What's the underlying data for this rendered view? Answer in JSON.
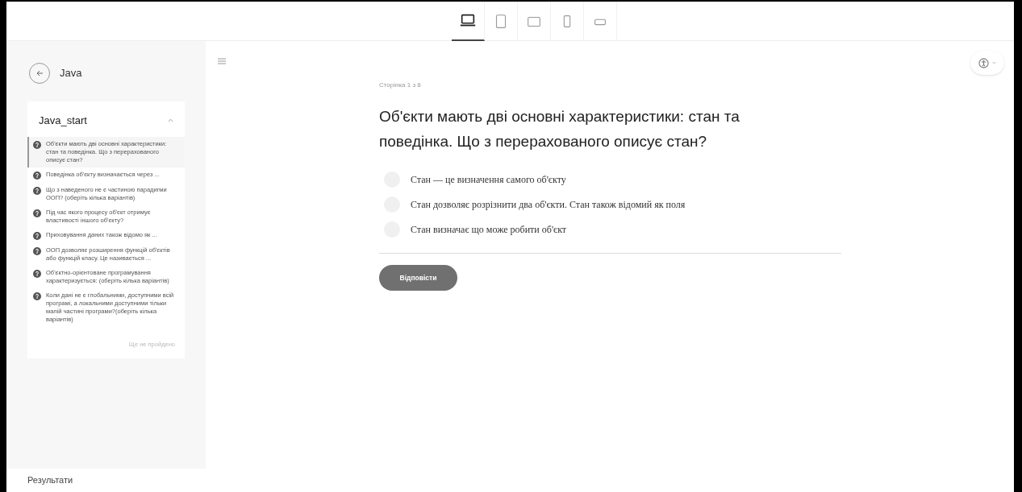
{
  "device_tabs": [
    {
      "kind": "laptop",
      "selected": true
    },
    {
      "kind": "tablet",
      "selected": false
    },
    {
      "kind": "tablet-landscape",
      "selected": false
    },
    {
      "kind": "phone",
      "selected": false
    },
    {
      "kind": "phone-landscape",
      "selected": false
    }
  ],
  "sidebar": {
    "back_label": "Java",
    "section": {
      "title": "Java_start",
      "expanded": true,
      "items": [
        {
          "text": "Об'єкти мають дві основні характеристики: стан та поведінка. Що з перерахованого описує стан?",
          "selected": true
        },
        {
          "text": "Поведінка об'єкту визначається через ...",
          "selected": false
        },
        {
          "text": "Що з наведеного не є частиною парадигми ООП? (оберіть кілька варіантів)",
          "selected": false
        },
        {
          "text": "Під час якого процесу об'єкт отримує властивості іншого об'єкту?",
          "selected": false
        },
        {
          "text": "Приховування даних також відомо як ...",
          "selected": false
        },
        {
          "text": "ООП дозволяє розширення функцій об'єктів або функцій класу. Це називається ...",
          "selected": false
        },
        {
          "text": "Об'єктно-орієнтоване програмування характеризується: (оберіть кілька варіантів)",
          "selected": false
        },
        {
          "text": "Коли дані не є глобальними, доступними всій програмі, а локальними доступними тільки малій частині програми?(оберіть кілька варіантів)",
          "selected": false
        }
      ],
      "status": "Ще не пройдено"
    },
    "results": "Результати"
  },
  "main": {
    "page_label": "Сторінка 1 з 8",
    "question": "Об'єкти мають дві основні характеристики: стан та поведінка. Що з перерахованого описує стан?",
    "options": [
      {
        "text": "Стан — це визначення самого об'єкту",
        "selected": false
      },
      {
        "text": "Стан дозволяє розрізнити два об'єкти. Стан також відомий як поля",
        "selected": false
      },
      {
        "text": "Стан визначає що може робити об'єкт",
        "selected": false
      }
    ],
    "submit": "Відповісти"
  }
}
